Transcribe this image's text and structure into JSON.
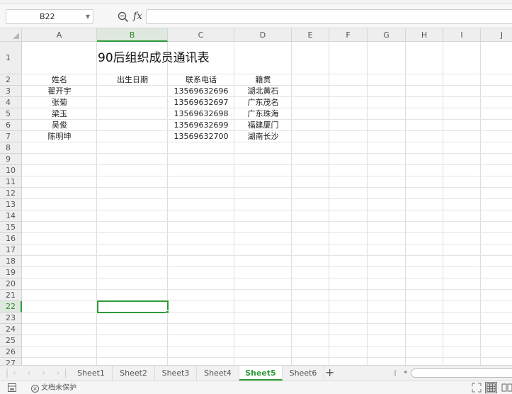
{
  "formula_bar": {
    "name_box": "B22",
    "fx_label": "fx",
    "formula_value": ""
  },
  "columns": [
    "A",
    "B",
    "C",
    "D",
    "E",
    "F",
    "G",
    "H",
    "I",
    "J"
  ],
  "selected_column": "B",
  "rows": [
    "1",
    "2",
    "3",
    "4",
    "5",
    "6",
    "7",
    "8",
    "9",
    "10",
    "11",
    "12",
    "13",
    "14",
    "15",
    "16",
    "17",
    "18",
    "19",
    "20",
    "21",
    "22",
    "23",
    "24",
    "25",
    "26",
    "27"
  ],
  "selected_row": "22",
  "sheet": {
    "title": "90后组织成员通讯表",
    "headers": [
      "姓名",
      "出生日期",
      "联系电话",
      "籍贯"
    ],
    "records": [
      {
        "name": "翟开宇",
        "birth": "",
        "phone": "13569632696",
        "origin": "湖北黄石"
      },
      {
        "name": "张菊",
        "birth": "",
        "phone": "13569632697",
        "origin": "广东茂名"
      },
      {
        "name": "梁玉",
        "birth": "",
        "phone": "13569632698",
        "origin": "广东珠海"
      },
      {
        "name": "吴俊",
        "birth": "",
        "phone": "13569632699",
        "origin": "福建厦门"
      },
      {
        "name": "陈明坤",
        "birth": "",
        "phone": "13569632700",
        "origin": "湖南长沙"
      }
    ]
  },
  "tabs": [
    {
      "label": "Sheet1",
      "active": false
    },
    {
      "label": "Sheet2",
      "active": false
    },
    {
      "label": "Sheet3",
      "active": false
    },
    {
      "label": "Sheet4",
      "active": false
    },
    {
      "label": "Sheet5",
      "active": true
    },
    {
      "label": "Sheet6",
      "active": false
    }
  ],
  "add_tab_label": "+",
  "status": {
    "protection": "文档未保护"
  },
  "colors": {
    "accent": "#2f9a3a",
    "header_bg": "#eeeeee"
  }
}
